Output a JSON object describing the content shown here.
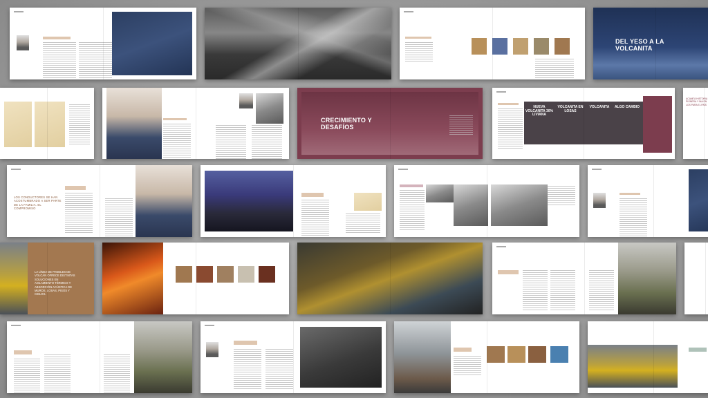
{
  "covers": {
    "yeso": "DEL YESO A LA VOLCANITA",
    "crecimiento": "CRECIMIENTO Y DESAFÍOS"
  },
  "quotes": {
    "spread9": "LOS CONDUCTORES SE HAN ACOSTUMBRADO A SER PARTE DE LA FAMILIA. EL COMPROMISO",
    "spread13": "LA LÍNEA DE PANELES DE VOLCÁN OFRECE DISTINTAS SOLUCIONES EN AISLAMIENTO TÉRMICO Y ABSORCIÓN ACÚSTICA DE MUROS, LOSAS, PISOS Y CIELOS."
  },
  "posters": {
    "p1": "NUEVA VOLCANITA 30% LIVIANA",
    "p2": "VOLCANITA EN LOSAS",
    "p3": "VOLCANITA",
    "p4": "ALGO CAMBIO"
  },
  "right_column": {
    "text": "ACANITA HISTORIA PIONERA Y NIA EN LOS PARA EL PAÍS"
  },
  "colors": {
    "blue": "#2c3f62",
    "rose": "#7c3d4e",
    "tan": "#a37850"
  }
}
